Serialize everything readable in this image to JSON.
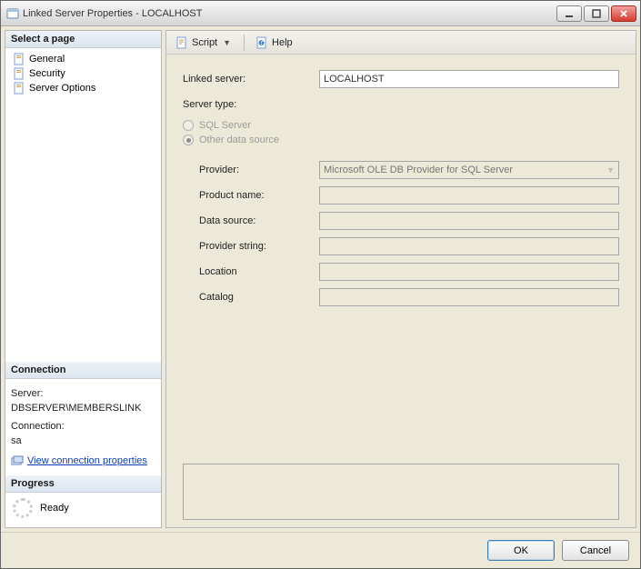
{
  "window": {
    "title": "Linked Server Properties - LOCALHOST"
  },
  "sidebar": {
    "select_header": "Select a page",
    "pages": [
      {
        "label": "General"
      },
      {
        "label": "Security"
      },
      {
        "label": "Server Options"
      }
    ],
    "connection_header": "Connection",
    "connection": {
      "server_label": "Server:",
      "server_value": "DBSERVER\\MEMBERSLINK",
      "connection_label": "Connection:",
      "connection_value": "sa",
      "view_props": "View connection properties"
    },
    "progress_header": "Progress",
    "progress_status": "Ready"
  },
  "toolbar": {
    "script": "Script",
    "help": "Help"
  },
  "form": {
    "linked_server_label": "Linked server:",
    "linked_server_value": "LOCALHOST",
    "server_type_label": "Server type:",
    "radio_sql": "SQL Server",
    "radio_other": "Other data source",
    "provider_label": "Provider:",
    "provider_value": "Microsoft OLE DB Provider for SQL Server",
    "product_name_label": "Product name:",
    "product_name_value": "",
    "data_source_label": "Data source:",
    "data_source_value": "",
    "provider_string_label": "Provider string:",
    "provider_string_value": "",
    "location_label": "Location",
    "location_value": "",
    "catalog_label": "Catalog",
    "catalog_value": ""
  },
  "footer": {
    "ok": "OK",
    "cancel": "Cancel"
  }
}
